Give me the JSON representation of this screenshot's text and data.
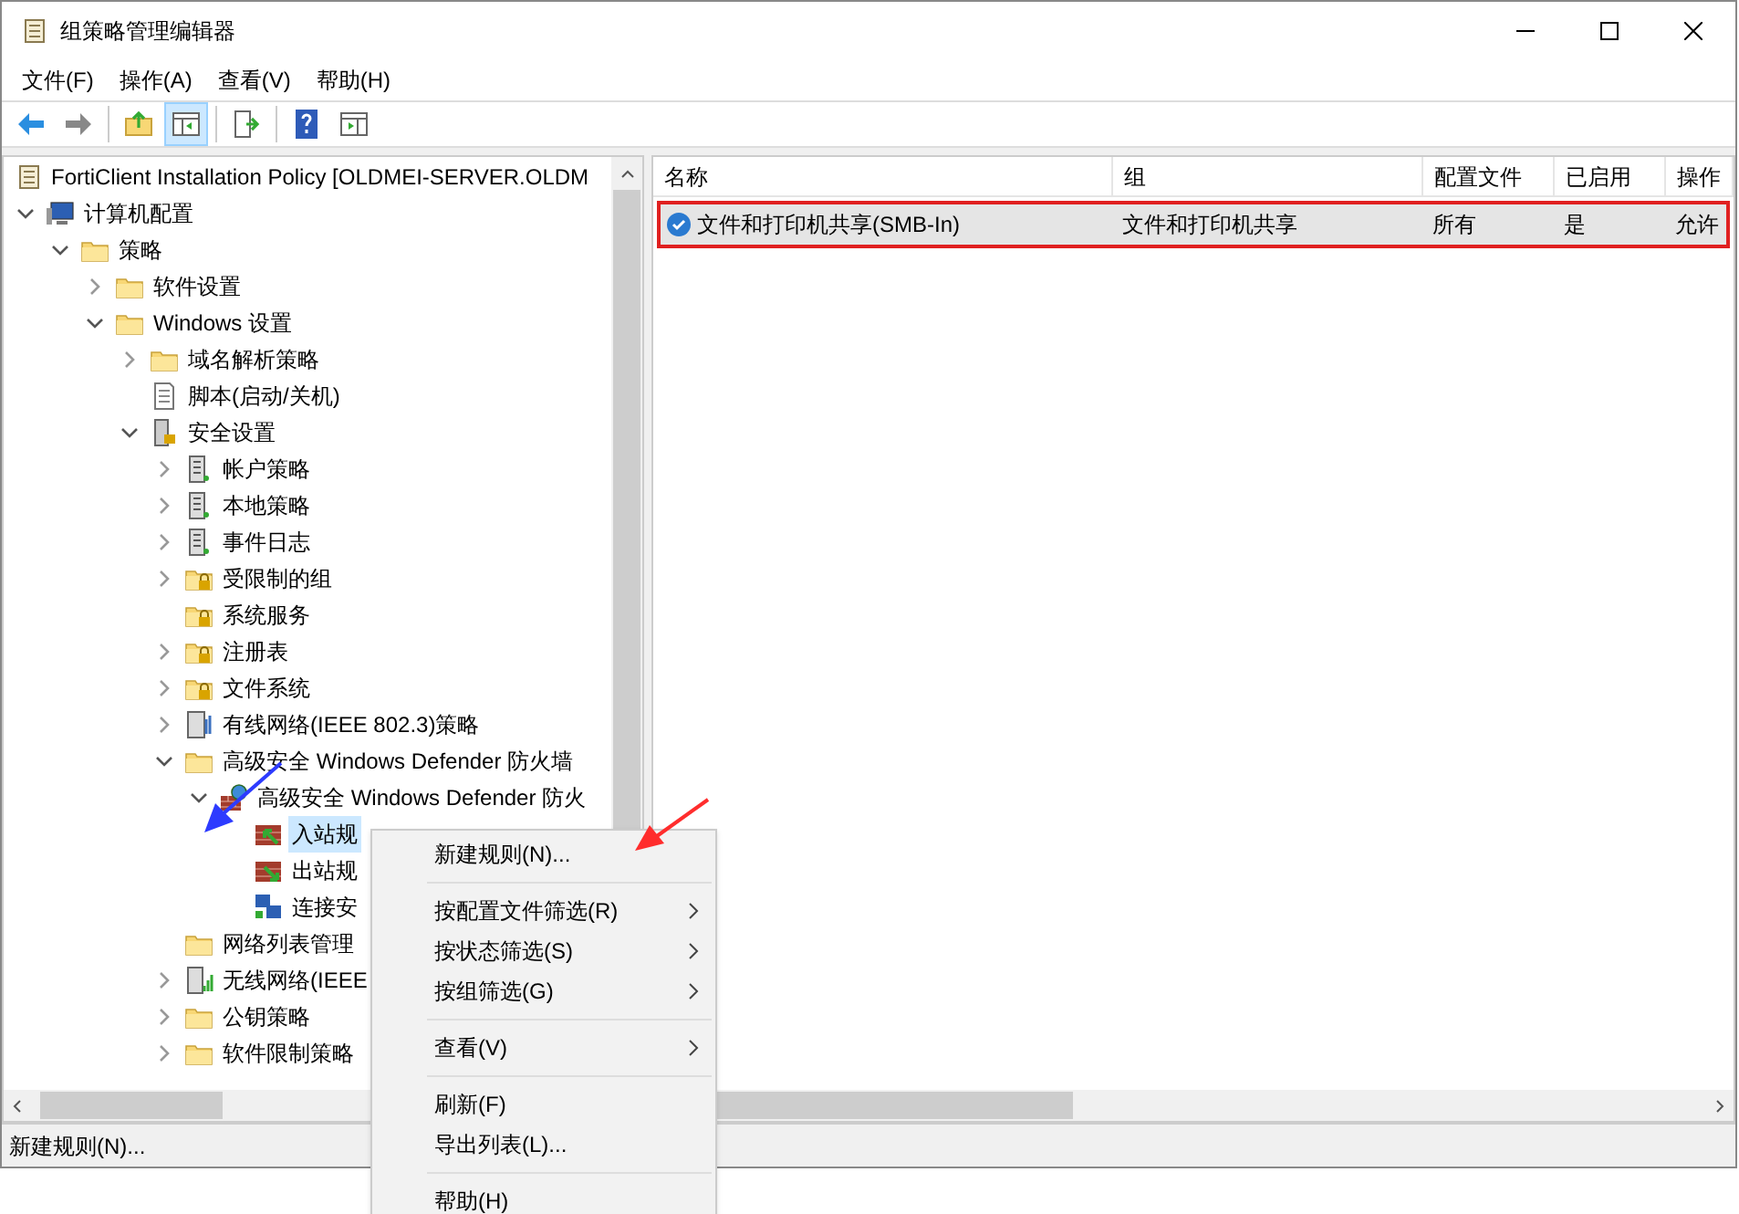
{
  "window": {
    "title": "组策略管理编辑器"
  },
  "menu_bar": [
    "文件(F)",
    "操作(A)",
    "查看(V)",
    "帮助(H)"
  ],
  "tree": {
    "root": "FortiClient Installation Policy [OLDMEI-SERVER.OLDM",
    "items": [
      {
        "label": "计算机配置",
        "kind": "computer",
        "expanded": true,
        "selected": false,
        "children": [
          {
            "label": "策略",
            "kind": "folder",
            "expanded": true,
            "selected": false,
            "children": [
              {
                "label": "软件设置",
                "kind": "folder",
                "expanded": false,
                "selected": false
              },
              {
                "label": "Windows 设置",
                "kind": "folder",
                "expanded": true,
                "selected": false,
                "children": [
                  {
                    "label": "域名解析策略",
                    "kind": "folder",
                    "expanded": false,
                    "selected": false
                  },
                  {
                    "label": "脚本(启动/关机)",
                    "kind": "script",
                    "selected": false
                  },
                  {
                    "label": "安全设置",
                    "kind": "security",
                    "expanded": true,
                    "selected": false,
                    "children": [
                      {
                        "label": "帐户策略",
                        "kind": "server",
                        "expanded": false,
                        "selected": false
                      },
                      {
                        "label": "本地策略",
                        "kind": "server",
                        "expanded": false,
                        "selected": false
                      },
                      {
                        "label": "事件日志",
                        "kind": "server",
                        "expanded": false,
                        "selected": false
                      },
                      {
                        "label": "受限制的组",
                        "kind": "locked-folder",
                        "expanded": false,
                        "selected": false
                      },
                      {
                        "label": "系统服务",
                        "kind": "locked-folder",
                        "selected": false
                      },
                      {
                        "label": "注册表",
                        "kind": "locked-folder",
                        "expanded": false,
                        "selected": false
                      },
                      {
                        "label": "文件系统",
                        "kind": "locked-folder",
                        "expanded": false,
                        "selected": false
                      },
                      {
                        "label": "有线网络(IEEE 802.3)策略",
                        "kind": "wired",
                        "expanded": false,
                        "selected": false
                      },
                      {
                        "label": "高级安全 Windows Defender 防火墙",
                        "kind": "folder",
                        "expanded": true,
                        "selected": false,
                        "children": [
                          {
                            "label": "高级安全 Windows Defender 防火",
                            "kind": "firewall-globe",
                            "expanded": true,
                            "selected": false,
                            "children": [
                              {
                                "label": "入站规",
                                "kind": "inbound",
                                "selected": true
                              },
                              {
                                "label": "出站规",
                                "kind": "outbound",
                                "selected": false
                              },
                              {
                                "label": "连接安",
                                "kind": "connection",
                                "selected": false
                              }
                            ]
                          }
                        ]
                      },
                      {
                        "label": "网络列表管理",
                        "kind": "folder",
                        "selected": false
                      },
                      {
                        "label": "无线网络(IEEE",
                        "kind": "wireless",
                        "expanded": false,
                        "selected": false
                      },
                      {
                        "label": "公钥策略",
                        "kind": "folder",
                        "expanded": false,
                        "selected": false
                      },
                      {
                        "label": "软件限制策略",
                        "kind": "folder",
                        "expanded": false,
                        "selected": false
                      }
                    ]
                  }
                ]
              }
            ]
          }
        ]
      }
    ]
  },
  "table": {
    "columns": [
      "名称",
      "组",
      "配置文件",
      "已启用",
      "操作"
    ],
    "rows": [
      {
        "cells": [
          "文件和打印机共享(SMB-In)",
          "文件和打印机共享",
          "所有",
          "是",
          "允许"
        ],
        "selected": true
      }
    ]
  },
  "context_menu": [
    {
      "kind": "item",
      "label": "新建规则(N)...",
      "submenu": false
    },
    {
      "kind": "separator"
    },
    {
      "kind": "item",
      "label": "按配置文件筛选(R)",
      "submenu": true
    },
    {
      "kind": "item",
      "label": "按状态筛选(S)",
      "submenu": true
    },
    {
      "kind": "item",
      "label": "按组筛选(G)",
      "submenu": true
    },
    {
      "kind": "separator"
    },
    {
      "kind": "item",
      "label": "查看(V)",
      "submenu": true
    },
    {
      "kind": "separator"
    },
    {
      "kind": "item",
      "label": "刷新(F)",
      "submenu": false
    },
    {
      "kind": "item",
      "label": "导出列表(L)...",
      "submenu": false
    },
    {
      "kind": "separator"
    },
    {
      "kind": "item",
      "label": "帮助(H)",
      "submenu": false
    }
  ],
  "status_bar": "新建规则(N)..."
}
